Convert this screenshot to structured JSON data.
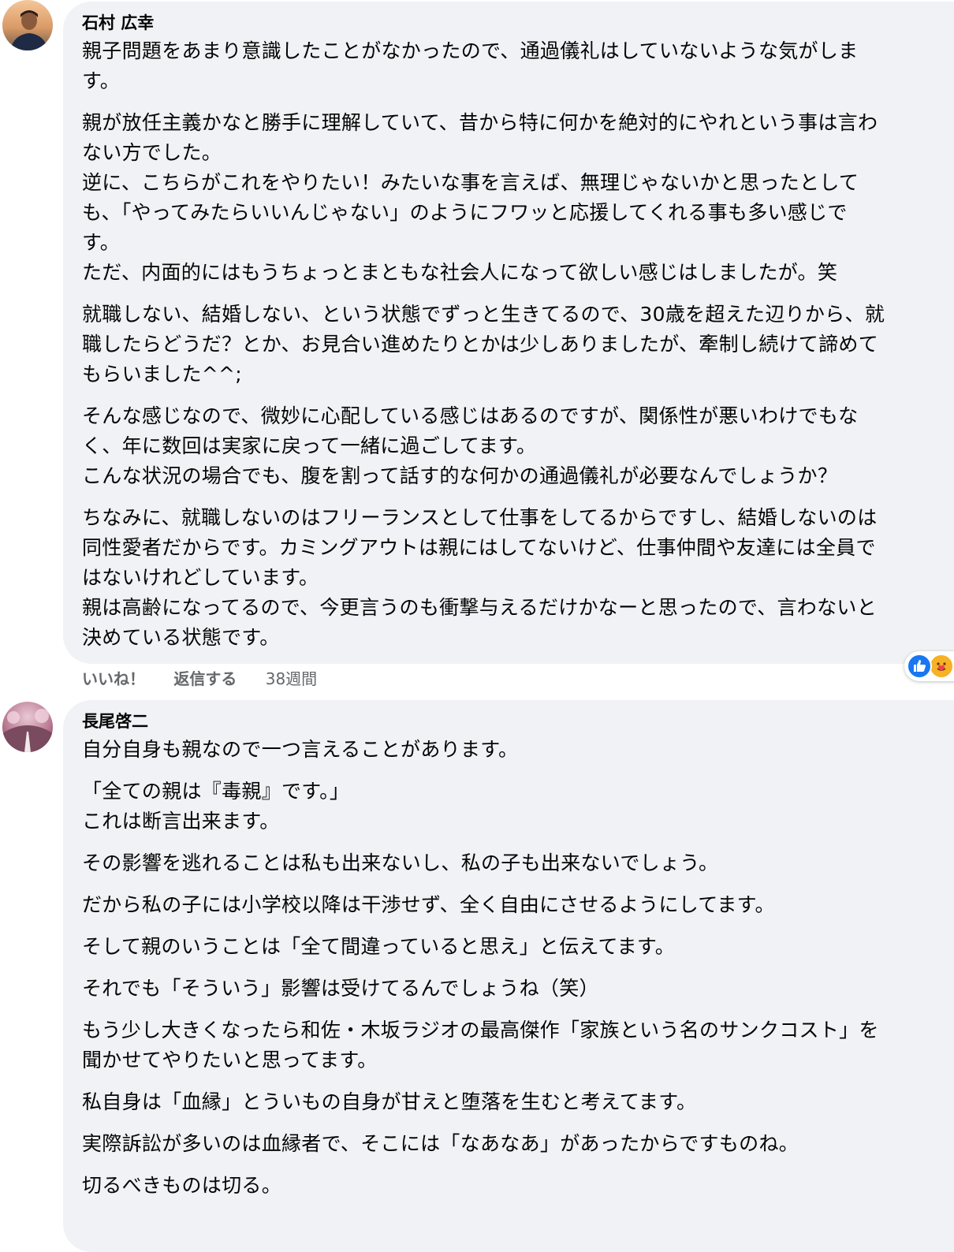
{
  "comments": [
    {
      "author": "石村 広幸",
      "paragraphs": [
        [
          "親子問題をあまり意識したことがなかったので、通過儀礼はしていないような気がしま",
          "す。"
        ],
        [
          "親が放任主義かなと勝手に理解していて、昔から特に何かを絶対的にやれという事は言わ",
          "ない方でした。",
          "逆に、こちらがこれをやりたい！みたいな事を言えば、無理じゃないかと思ったとして",
          "も、「やってみたらいいんじゃない」のようにフワッと応援してくれる事も多い感じで",
          "す。",
          "ただ、内面的にはもうちょっとまともな社会人になって欲しい感じはしましたが。笑"
        ],
        [
          "就職しない、結婚しない、という状態でずっと生きてるので、30歳を超えた辺りから、就",
          "職したらどうだ？とか、お見合い進めたりとかは少しありましたが、牽制し続けて諦めて",
          "もらいました^^;"
        ],
        [
          "そんな感じなので、微妙に心配している感じはあるのですが、関係性が悪いわけでもな",
          "く、年に数回は実家に戻って一緒に過ごしてます。",
          "こんな状況の場合でも、腹を割って話す的な何かの通過儀礼が必要なんでしょうか？"
        ],
        [
          "ちなみに、就職しないのはフリーランスとして仕事をしてるからですし、結婚しないのは",
          "同性愛者だからです。カミングアウトは親にはしてないけど、仕事仲間や友達には全員で",
          "はないけれどしています。",
          "親は高齢になってるので、今更言うのも衝撃与えるだけかなーと思ったので、言わないと",
          "決めている状態です。"
        ]
      ],
      "actions": {
        "like": "いいね！",
        "reply": "返信する",
        "time": "38週間"
      }
    },
    {
      "author": "長尾啓二",
      "paragraphs": [
        [
          "自分自身も親なので一つ言えることがあります。"
        ],
        [
          "「全ての親は『毒親』です。」",
          "これは断言出来ます。"
        ],
        [
          "その影響を逃れることは私も出来ないし、私の子も出来ないでしょう。"
        ],
        [
          "だから私の子には小学校以降は干渉せず、全く自由にさせるようにしてます。"
        ],
        [
          "そして親のいうことは「全て間違っていると思え」と伝えてます。"
        ],
        [
          "それでも「そういう」影響は受けてるんでしょうね（笑）"
        ],
        [
          "もう少し大きくなったら和佐・木坂ラジオの最高傑作「家族という名のサンクコスト」を",
          "聞かせてやりたいと思ってます。"
        ],
        [
          "私自身は「血縁」とういもの自身が甘えと堕落を生むと考えてます。"
        ],
        [
          "実際訴訟が多いのは血縁者で、そこには「なあなあ」があったからですものね。"
        ],
        [
          "切るべきものは切る。"
        ]
      ]
    }
  ],
  "reactions": {
    "icons": [
      "like-icon",
      "care-icon"
    ],
    "colors": {
      "like": "#1877f2",
      "care": "#f7b125"
    }
  },
  "colors": {
    "bubble": "#f0f2f5",
    "text": "#050505",
    "secondary": "#65676b"
  }
}
